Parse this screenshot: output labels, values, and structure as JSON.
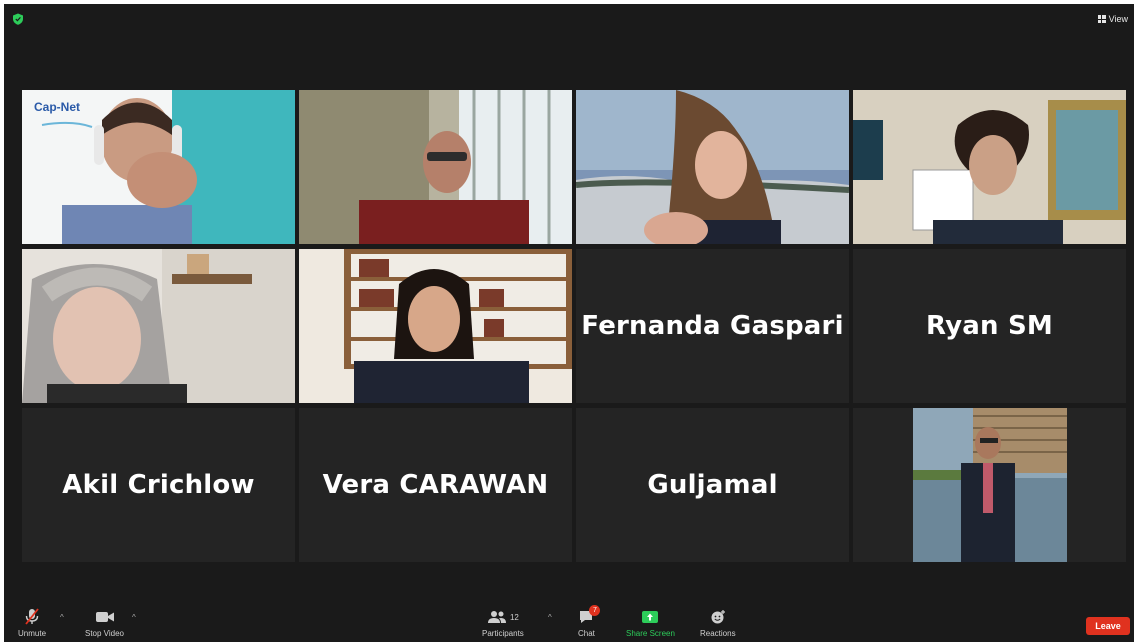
{
  "window": {
    "view_label": "View"
  },
  "tiles": {
    "t1": {
      "logo": "Cap-Net"
    },
    "t7": {
      "name": "Fernanda Gaspari"
    },
    "t8": {
      "name": "Ryan SM"
    },
    "t9": {
      "name": "Akil Crichlow"
    },
    "t10": {
      "name": "Vera CARAWAN"
    },
    "t11": {
      "name": "Guljamal"
    }
  },
  "toolbar": {
    "unmute_label": "Unmute",
    "stop_video_label": "Stop Video",
    "participants_label": "Participants",
    "participants_count": "12",
    "chat_label": "Chat",
    "chat_badge": "7",
    "share_label": "Share Screen",
    "reactions_label": "Reactions",
    "leave_label": "Leave"
  },
  "colors": {
    "active_speaker": "#c8e06a",
    "share": "#2dcc5a",
    "leave": "#e0321f"
  }
}
